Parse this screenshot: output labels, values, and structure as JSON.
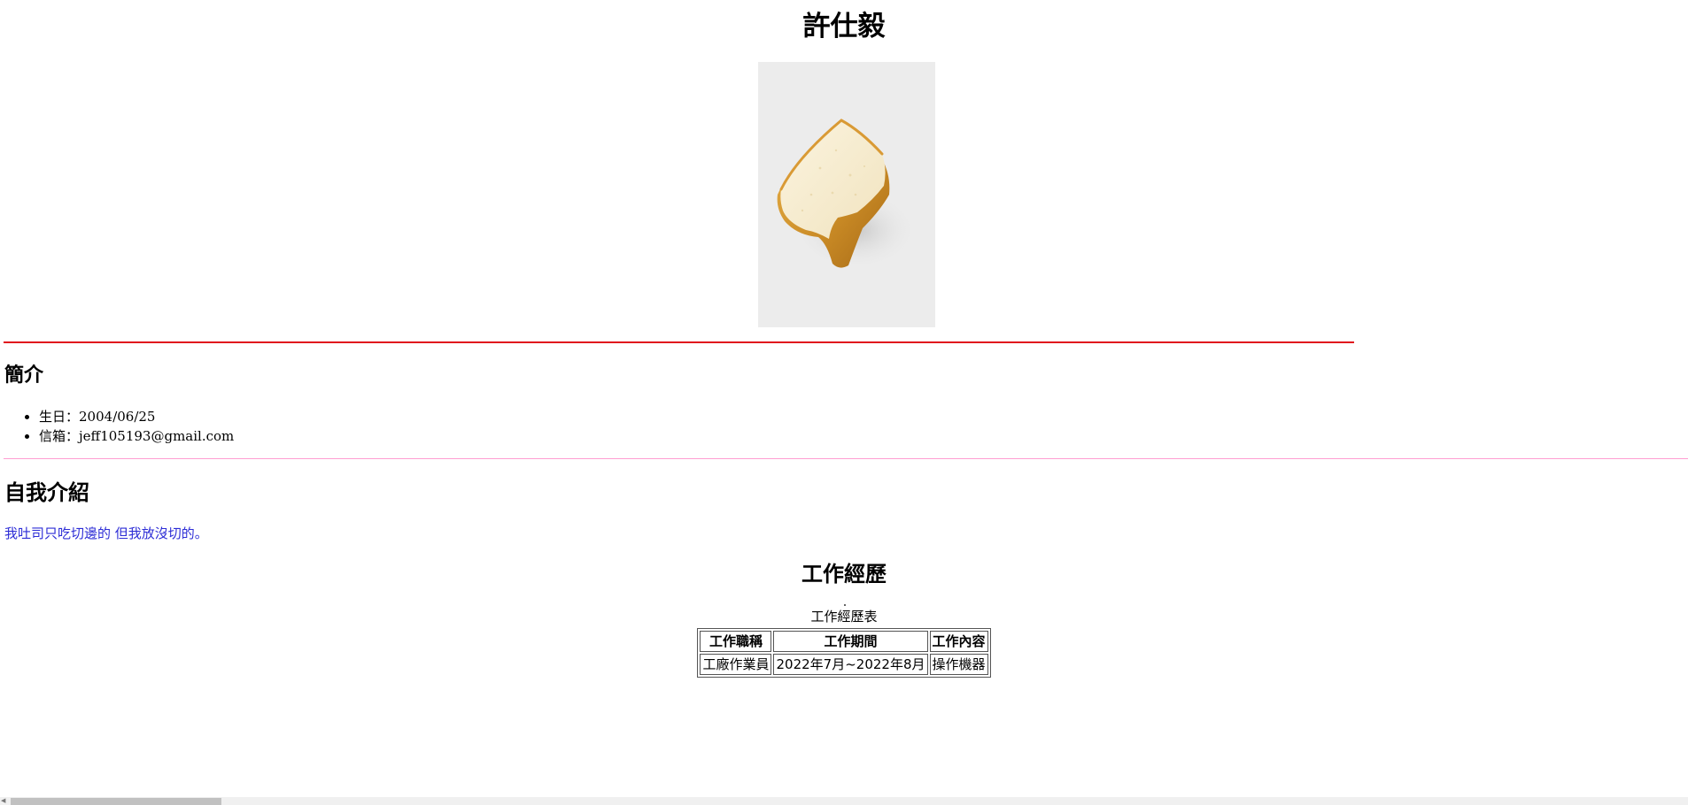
{
  "page": {
    "title": "許仕毅"
  },
  "photo": {
    "subject": "toast-slice-image"
  },
  "intro": {
    "heading": "簡介",
    "items": [
      {
        "label": "生日：",
        "value": "2004/06/25"
      },
      {
        "label": "信箱：",
        "value": "jeff105193@gmail.com"
      }
    ]
  },
  "self_intro": {
    "heading": "自我介紹",
    "text": "我吐司只吃切邊的 但我放沒切的。"
  },
  "work": {
    "heading": "工作經歷",
    "caption": "工作經歷表",
    "columns": [
      "工作職稱",
      "工作期間",
      "工作內容"
    ],
    "rows": [
      [
        "工廠作業員",
        "2022年7月~2022年8月",
        "操作機器"
      ]
    ]
  },
  "colors": {
    "red_rule": "#e0141d",
    "pink_rule": "#ff9ed2",
    "self_text": "#2d2dd6",
    "photo_bg": "#ececec"
  }
}
